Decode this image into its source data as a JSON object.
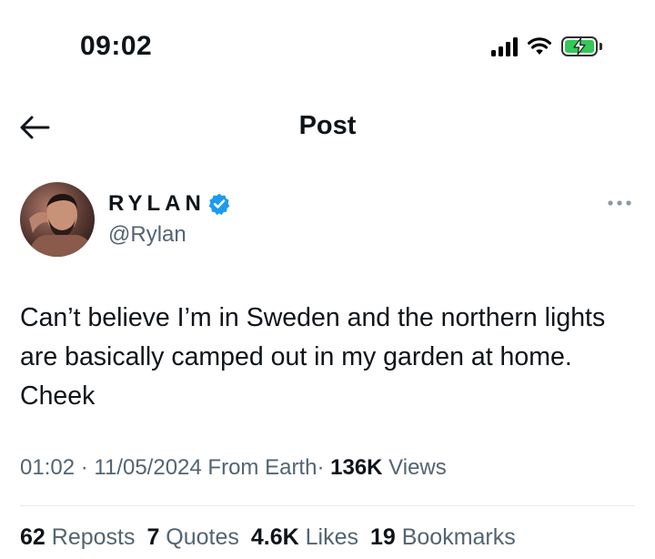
{
  "status_bar": {
    "time": "09:02",
    "battery_color": "#34c759"
  },
  "nav": {
    "title": "Post",
    "back_icon": "arrow-left-icon"
  },
  "author": {
    "display_name": "RYLAN",
    "handle": "@Rylan",
    "verified": true,
    "verified_color": "#1d9bf0",
    "more_icon": "more-horizontal-icon"
  },
  "tweet": {
    "text": "Can’t believe I’m in Sweden and the northern lights are basically camped out in my garden at home. Cheek"
  },
  "meta": {
    "time": "01:02",
    "sep1": "·",
    "date": "11/05/2024",
    "location": "From Earth",
    "sep2": "·",
    "views_count": "136K",
    "views_label": "Views"
  },
  "stats": {
    "reposts_count": "62",
    "reposts_label": "Reposts",
    "quotes_count": "7",
    "quotes_label": "Quotes",
    "likes_count": "4.6K",
    "likes_label": "Likes",
    "bookmarks_count": "19",
    "bookmarks_label": "Bookmarks"
  }
}
